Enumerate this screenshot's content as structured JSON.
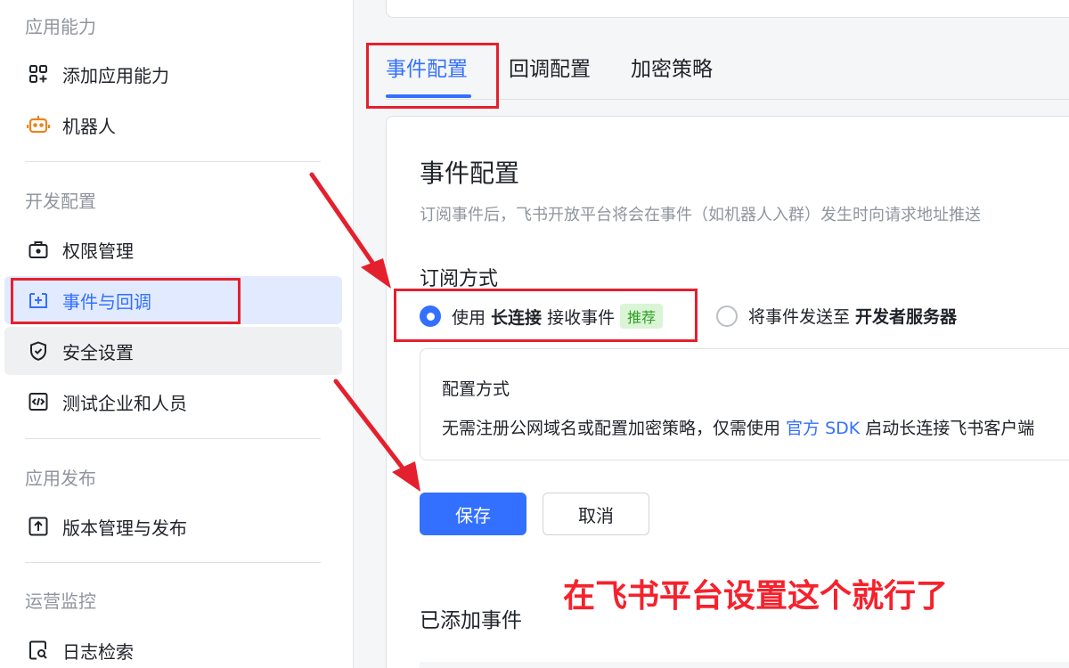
{
  "sidebar": {
    "sections": [
      {
        "title": "应用能力"
      },
      {
        "title": "开发配置"
      },
      {
        "title": "应用发布"
      },
      {
        "title": "运营监控"
      }
    ],
    "items": [
      {
        "label": "添加应用能力",
        "icon": "apps-add-icon"
      },
      {
        "label": "机器人",
        "icon": "robot-icon"
      },
      {
        "label": "权限管理",
        "icon": "briefcase-lock-icon"
      },
      {
        "label": "事件与回调",
        "icon": "event-plus-icon"
      },
      {
        "label": "安全设置",
        "icon": "shield-check-icon"
      },
      {
        "label": "测试企业和人员",
        "icon": "code-box-icon"
      },
      {
        "label": "版本管理与发布",
        "icon": "upload-box-icon"
      },
      {
        "label": "日志检索",
        "icon": "log-search-icon"
      }
    ]
  },
  "tabs": [
    {
      "label": "事件配置",
      "active": true
    },
    {
      "label": "回调配置",
      "active": false
    },
    {
      "label": "加密策略",
      "active": false
    }
  ],
  "event_config": {
    "title": "事件配置",
    "description": "订阅事件后，飞书开放平台将会在事件（如机器人入群）发生时向请求地址推送",
    "subscribe_label": "订阅方式",
    "options": {
      "long_conn": {
        "pre": "使用 ",
        "bold": "长连接",
        "post": " 接收事件",
        "badge": "推荐",
        "checked": true
      },
      "server": {
        "pre": "将事件发送至 ",
        "bold": "开发者服务器",
        "checked": false
      }
    },
    "info": {
      "title": "配置方式",
      "text_pre": "无需注册公网域名或配置加密策略，仅需使用 ",
      "link": "官方 SDK",
      "text_post": " 启动长连接飞书客户端"
    },
    "save_label": "保存",
    "cancel_label": "取消",
    "added_title": "已添加事件"
  },
  "annotation": {
    "text": "在飞书平台设置这个就行了",
    "color": "#e5202e"
  },
  "colors": {
    "accent": "#3370ff",
    "badge_green": "#2ea121",
    "annotation_red": "#e5202e"
  }
}
